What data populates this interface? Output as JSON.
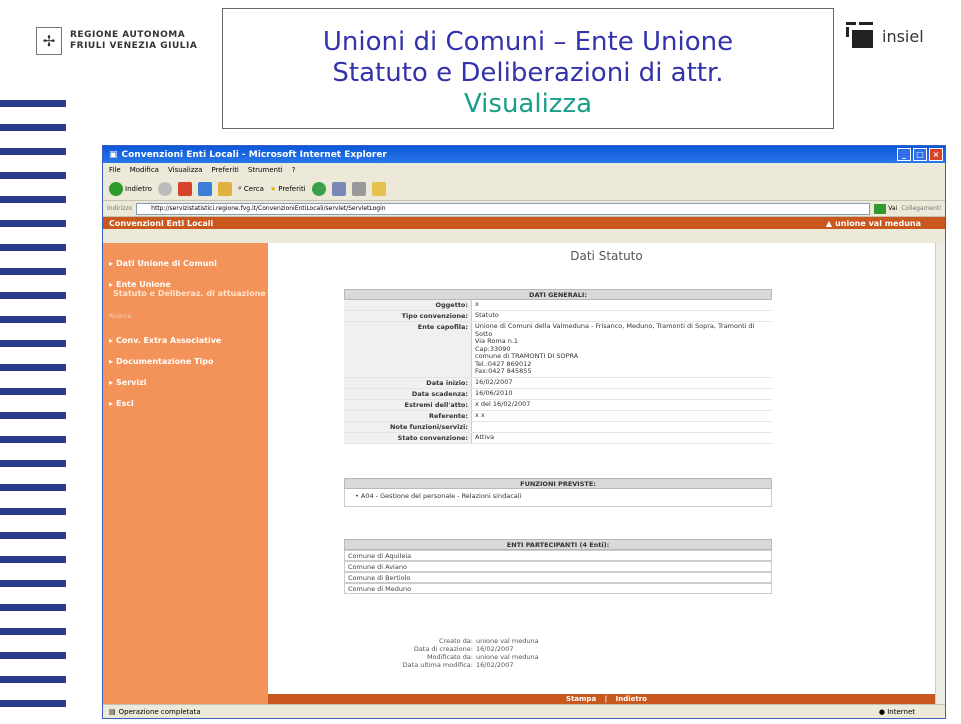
{
  "slide": {
    "region_name": "REGIONE AUTONOMA FRIULI VENEZIA GIULIA",
    "region_line1": "REGIONE AUTONOMA",
    "region_line2": "FRIULI VENEZIA GIULIA",
    "title_line1": "Unioni di Comuni – Ente Unione",
    "title_line2": "Statuto e Deliberazioni di attr.",
    "title_line3": "Visualizza",
    "company": "insiel"
  },
  "browser": {
    "window_title": "Convenzioni Enti Locali - Microsoft Internet Explorer",
    "menu": [
      "File",
      "Modifica",
      "Visualizza",
      "Preferiti",
      "Strumenti",
      "?"
    ],
    "toolbar": {
      "back": "Indietro",
      "search": "Cerca",
      "favorites": "Preferiti"
    },
    "address_label": "Indirizzo",
    "address": "http://servizistatistici.regione.fvg.it/ConvenzioniEntiLocali/servlet/ServletLogin",
    "go": "Vai",
    "links": "Collegamenti",
    "status": "Operazione completata",
    "zone": "Internet"
  },
  "app": {
    "name": "Convenzioni Enti Locali",
    "user": "unione val meduna",
    "sidebar": {
      "dati_unione": "Dati Unione di Comuni",
      "ente_unione": "Ente Unione",
      "statuto": "Statuto e Deliberaz. di attuazione",
      "ricerca": "Ricerca",
      "conv_extra": "Conv. Extra Associative",
      "documentazione": "Documentazione Tipo",
      "servizi": "Servizi",
      "esci": "Esci"
    },
    "page_title": "Dati Statuto",
    "dati_generali": {
      "header": "DATI GENERALI:",
      "oggetto_label": "Oggetto:",
      "oggetto": "x",
      "tipo_label": "Tipo convenzione:",
      "tipo": "Statuto",
      "ente_label": "Ente capofila:",
      "ente_line1": "Unione di Comuni della Valmeduna - Frisanco, Meduno, Tramonti di Sopra, Tramonti di Sotto",
      "ente_line2": "Via Roma n.1",
      "ente_line3": "Cap:33090",
      "ente_line4": "comune di TRAMONTI DI SOPRA",
      "ente_line5": "Tel.:0427 869012",
      "ente_line6": "Fax:0427 845855",
      "data_inizio_label": "Data inizio:",
      "data_inizio": "16/02/2007",
      "data_scadenza_label": "Data scadenza:",
      "data_scadenza": "16/06/2010",
      "estremi_label": "Estremi dell'atto:",
      "estremi": "x del 16/02/2007",
      "referente_label": "Referente:",
      "referente": "x x",
      "note_label": "Note funzioni/servizi:",
      "note": "",
      "stato_label": "Stato convenzione:",
      "stato": "Attiva"
    },
    "funzioni": {
      "header": "FUNZIONI PREVISTE:",
      "item1": "A04 - Gestione del personale - Relazioni sindacali"
    },
    "enti": {
      "header": "ENTI PARTECIPANTI (4 Enti):",
      "e1": "Comune di Aquileia",
      "e2": "Comune di Aviano",
      "e3": "Comune di Bertiolo",
      "e4": "Comune di Meduno"
    },
    "meta": {
      "creato_label": "Creato da:",
      "creato": "unione val meduna",
      "data_creazione_label": "Data di creazione:",
      "data_creazione": "16/02/2007",
      "modificato_label": "Modificato da:",
      "modificato": "unione val meduna",
      "data_modifica_label": "Data ultima modifica:",
      "data_modifica": "16/02/2007"
    },
    "footer": {
      "stampa": "Stampa",
      "sep": "|",
      "indietro": "Indietro"
    }
  }
}
